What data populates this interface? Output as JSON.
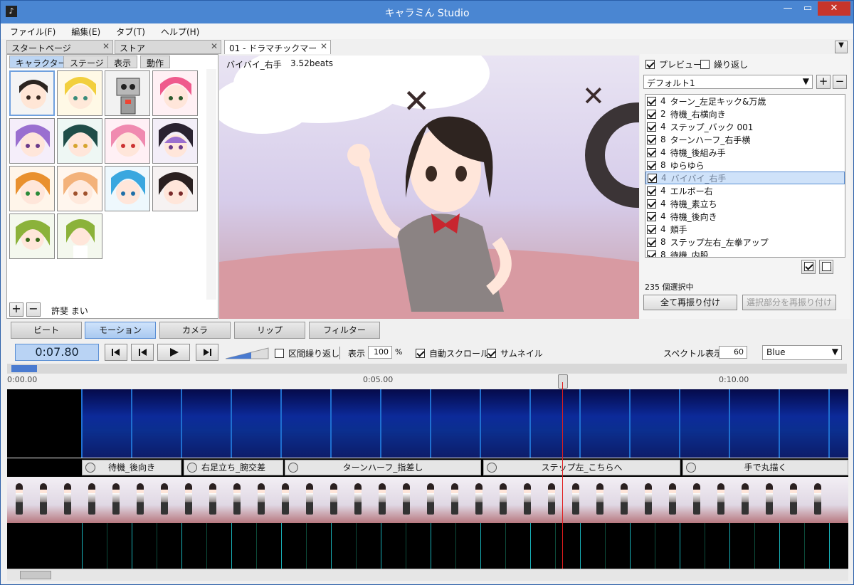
{
  "title": "キャラミん Studio",
  "menu": [
    "ファイル(F)",
    "編集(E)",
    "タブ(T)",
    "ヘルプ(H)"
  ],
  "tabs": [
    {
      "label": "スタートページ"
    },
    {
      "label": "ストア"
    },
    {
      "label": "01 - ドラマチックマーケ…"
    }
  ],
  "subtabs": [
    "キャラクター",
    "ステージ",
    "表示",
    "動作"
  ],
  "selected_character": "許斐 まい",
  "viewport": {
    "motion_label": "バイバイ_右手",
    "beats": "3.52beats"
  },
  "right": {
    "preview_label": "プレビュー",
    "repeat_label": "繰り返し",
    "preset": "デフォルト1",
    "items": [
      {
        "n": "4",
        "name": "ターン_左足キック&万歳",
        "sel": false
      },
      {
        "n": "2",
        "name": "待機_右横向き",
        "sel": false
      },
      {
        "n": "4",
        "name": "ステップ_バック 001",
        "sel": false
      },
      {
        "n": "8",
        "name": "ターンハーフ_右手横",
        "sel": false
      },
      {
        "n": "4",
        "name": "待機_後組み手",
        "sel": false
      },
      {
        "n": "8",
        "name": "ゆらゆら",
        "sel": false
      },
      {
        "n": "4",
        "name": "バイバイ_右手",
        "sel": true
      },
      {
        "n": "4",
        "name": "エルボー右",
        "sel": false
      },
      {
        "n": "4",
        "name": "待機_素立ち",
        "sel": false
      },
      {
        "n": "4",
        "name": "待機_後向き",
        "sel": false
      },
      {
        "n": "4",
        "name": "頬手",
        "sel": false
      },
      {
        "n": "8",
        "name": "ステップ左右_左拳アップ",
        "sel": false
      },
      {
        "n": "8",
        "name": "待機_内股",
        "sel": false
      }
    ],
    "count_text": "235 個選択中",
    "reassign_all": "全て再振り付け",
    "reassign_sel": "選択部分を再振り付け"
  },
  "modes": [
    "ビート",
    "モーション",
    "カメラ",
    "リップ",
    "フィルター"
  ],
  "transport": {
    "time": "0:07.80",
    "loop_label": "区間繰り返し",
    "display_label": "表示",
    "zoom": "100",
    "percent": "%",
    "autoscroll_label": "自動スクロール",
    "thumbnail_label": "サムネイル",
    "spectrum_label": "スペクトル表示",
    "spectrum_value": "60",
    "color_option": "Blue"
  },
  "ruler": [
    "0:00.00",
    "0:05.00",
    "0:10.00"
  ],
  "motion_labels": [
    "待機_後向き",
    "右足立ち_腕交差",
    "ターンハーフ_指差し",
    "ステップ左_こちらへ",
    "手で丸描く"
  ]
}
